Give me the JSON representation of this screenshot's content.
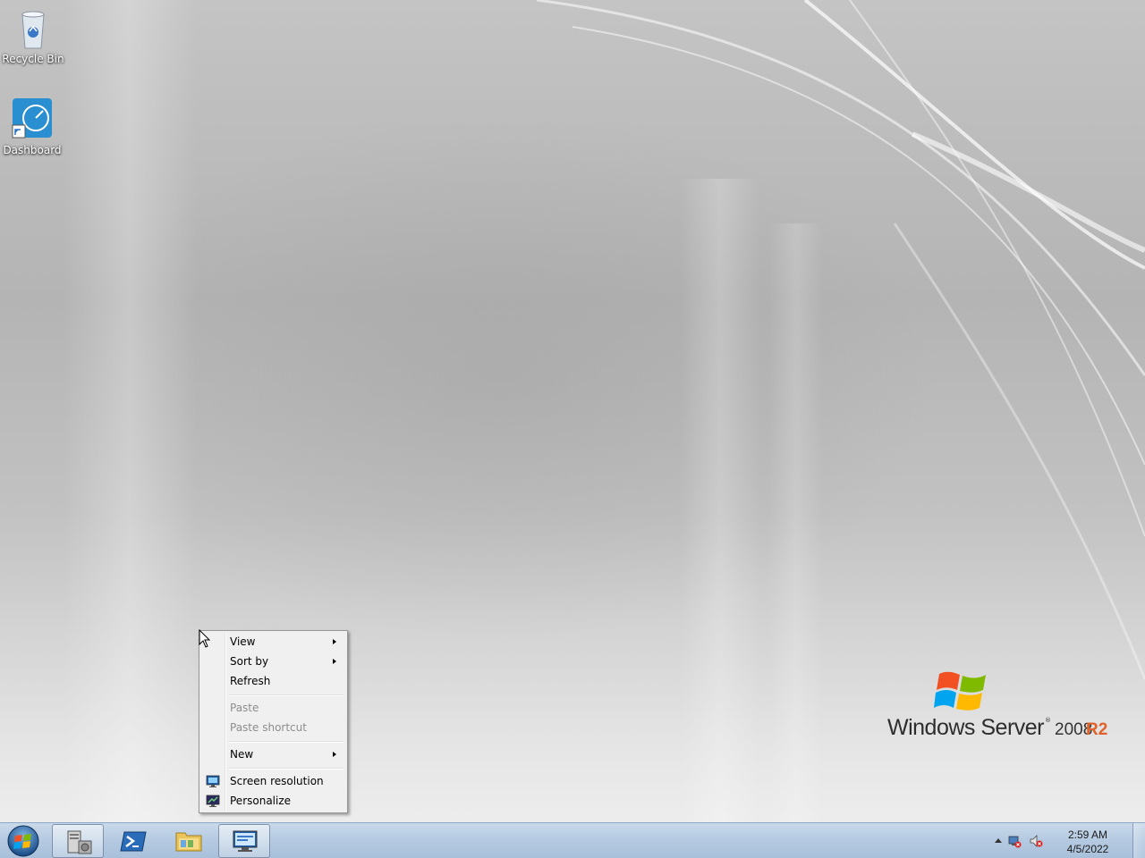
{
  "desktop": {
    "icons": [
      {
        "label": "Recycle Bin",
        "icon": "recycle-bin-icon"
      },
      {
        "label": "Dashboard",
        "icon": "dashboard-icon"
      }
    ]
  },
  "branding": {
    "product": "Windows Server",
    "trademark": "®",
    "version": "2008",
    "release": "R2",
    "release_color": "#e0622a"
  },
  "context_menu": {
    "items": [
      {
        "label": "View",
        "has_submenu": true,
        "enabled": true
      },
      {
        "label": "Sort by",
        "has_submenu": true,
        "enabled": true
      },
      {
        "label": "Refresh",
        "has_submenu": false,
        "enabled": true
      },
      {
        "label": "Paste",
        "has_submenu": false,
        "enabled": false
      },
      {
        "label": "Paste shortcut",
        "has_submenu": false,
        "enabled": false
      },
      {
        "label": "New",
        "has_submenu": true,
        "enabled": true
      },
      {
        "label": "Screen resolution",
        "has_submenu": false,
        "enabled": true,
        "icon": "screen-resolution-icon"
      },
      {
        "label": "Personalize",
        "has_submenu": false,
        "enabled": true,
        "icon": "personalize-icon"
      }
    ]
  },
  "taskbar": {
    "start_icon": "windows-start-icon",
    "pinned": [
      {
        "icon": "server-manager-icon",
        "active": true
      },
      {
        "icon": "powershell-icon",
        "active": false
      },
      {
        "icon": "file-explorer-icon",
        "active": false
      },
      {
        "icon": "remote-desktop-icon",
        "active": true
      }
    ],
    "tray": {
      "icons": [
        "network-disconnected-icon",
        "volume-muted-icon"
      ],
      "time": "2:59 AM",
      "date": "4/5/2022"
    }
  },
  "colors": {
    "taskbar": "#b6cbe2",
    "menu_background": "#f0f0f0",
    "disabled_text": "#8d8d8d"
  }
}
